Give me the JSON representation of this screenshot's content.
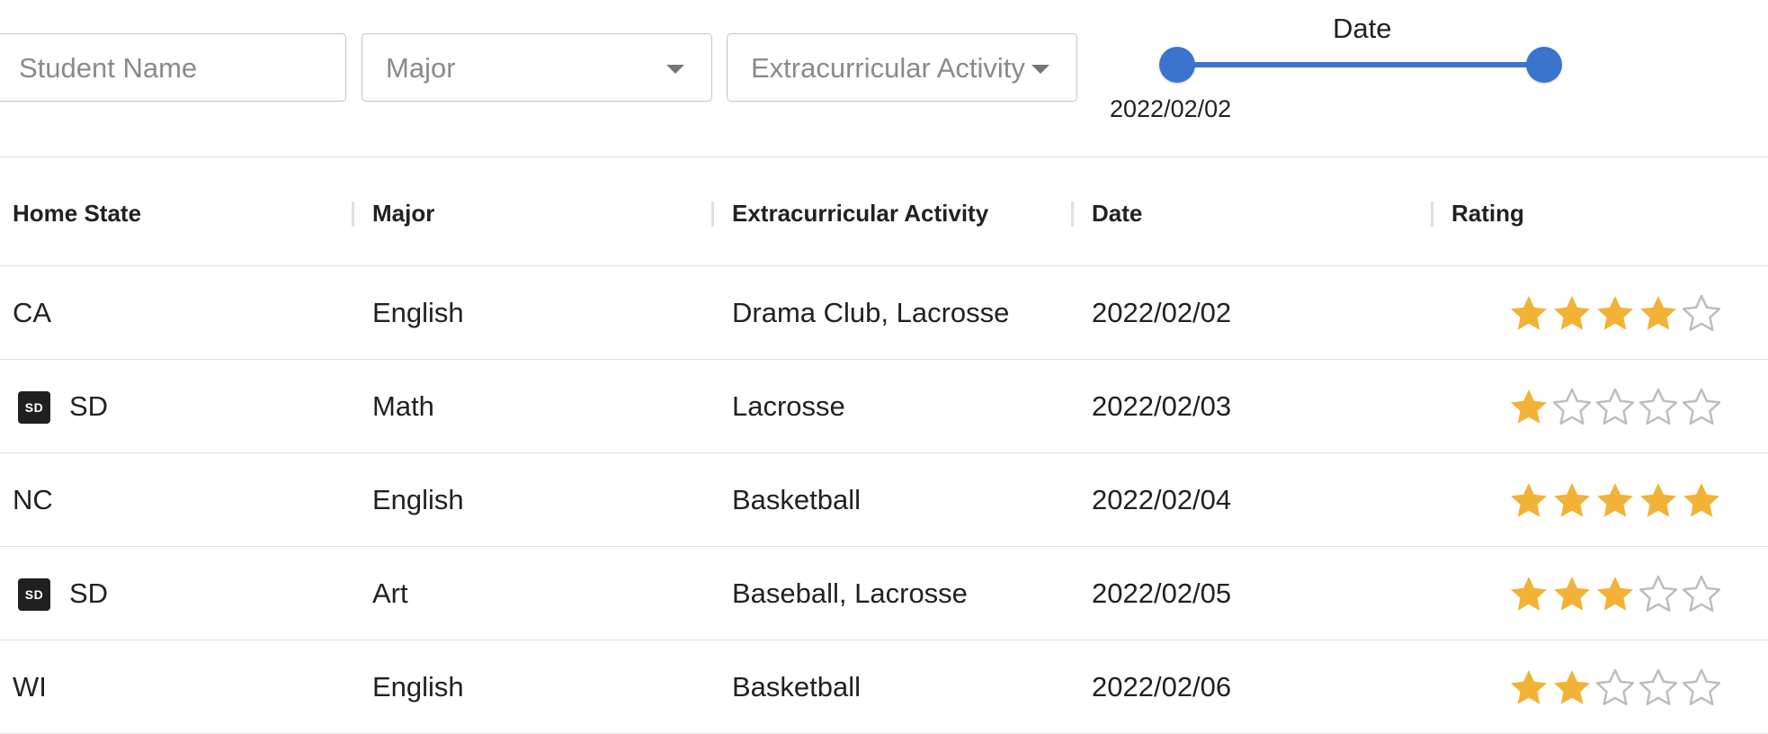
{
  "filters": {
    "student_name_placeholder": "Student Name",
    "major_placeholder": "Major",
    "extracurricular_placeholder": "Extracurricular Activity",
    "date_slider": {
      "label": "Date",
      "value_label": "2022/02/02"
    }
  },
  "table": {
    "columns": [
      "Home State",
      "Major",
      "Extracurricular Activity",
      "Date",
      "Rating"
    ],
    "rows": [
      {
        "state": "CA",
        "state_icon_text": "",
        "major": "English",
        "activities": "Drama Club, Lacrosse",
        "date": "2022/02/02",
        "rating": 4
      },
      {
        "state": "SD",
        "state_icon_text": "SD",
        "major": "Math",
        "activities": "Lacrosse",
        "date": "2022/02/03",
        "rating": 1
      },
      {
        "state": "NC",
        "state_icon_text": "",
        "major": "English",
        "activities": "Basketball",
        "date": "2022/02/04",
        "rating": 5
      },
      {
        "state": "SD",
        "state_icon_text": "SD",
        "major": "Art",
        "activities": "Baseball, Lacrosse",
        "date": "2022/02/05",
        "rating": 3
      },
      {
        "state": "WI",
        "state_icon_text": "",
        "major": "English",
        "activities": "Basketball",
        "date": "2022/02/06",
        "rating": 2
      }
    ],
    "rating_max": 5
  },
  "colors": {
    "accent": "#3b74cf",
    "star_filled": "#f2b236",
    "star_empty_stroke": "#bdbdbd"
  }
}
